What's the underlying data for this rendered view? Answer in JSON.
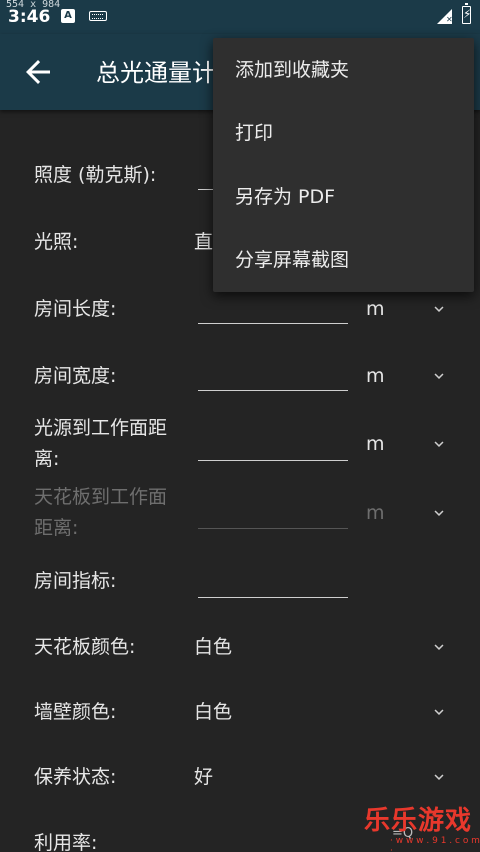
{
  "status_bar": {
    "dimensions_label": "554 x 984",
    "time": "3:46",
    "notif_letter": "A",
    "icons": [
      "keyboard-icon",
      "signal-icon",
      "battery-icon"
    ]
  },
  "app_bar": {
    "title": "总光通量计算",
    "back_icon": "arrow-left-icon"
  },
  "form": {
    "illuminance_label": "照度 (勒克斯):",
    "lighting_label": "光照:",
    "lighting_value": "直",
    "room_length_label": "房间长度:",
    "room_length_unit": "m",
    "room_width_label": "房间宽度:",
    "room_width_unit": "m",
    "source_distance_label_1": "光源到工作面距",
    "source_distance_label_2": "离:",
    "source_distance_unit": "m",
    "ceiling_distance_label_1": "天花板到工作面",
    "ceiling_distance_label_2": "距离:",
    "ceiling_distance_unit": "m",
    "room_index_label": "房间指标:",
    "ceiling_color_label": "天花板颜色:",
    "ceiling_color_value": "白色",
    "wall_color_label": "墙壁颜色:",
    "wall_color_value": "白色",
    "maintenance_label": "保养状态:",
    "maintenance_value": "好",
    "utilization_label": "利用率:"
  },
  "menu": {
    "items": [
      "添加到收藏夹",
      "打印",
      "另存为 PDF",
      "分享屏幕截图"
    ]
  },
  "watermark": {
    "text": "乐乐游戏",
    "url": "· w w w . 9 1 . c o m ·"
  },
  "colors": {
    "app_bar": "#1b3a48",
    "background": "#242424",
    "menu": "#2f2f2f",
    "watermark": "#e8382c"
  }
}
